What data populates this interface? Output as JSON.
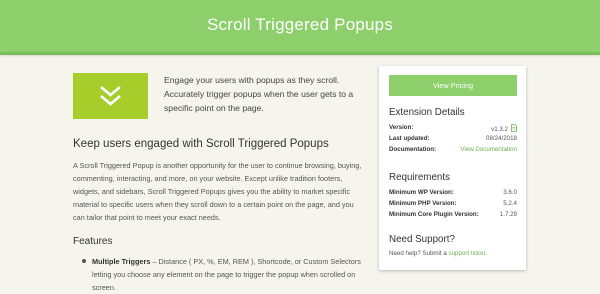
{
  "header": {
    "title": "Scroll Triggered Popups"
  },
  "hero": {
    "icon": "double-chevron-down-icon",
    "text": "Engage your users with popups as they scroll. Accurately trigger popups when the user gets to a specific point on the page."
  },
  "main": {
    "heading": "Keep users engaged with Scroll Triggered Popups",
    "body": "A Scroll Triggered Popup is another opportunity for the user to continue browsing, buying, commenting, interacting, and more, on your website. Except unlike tradition footers, widgets, and sidebars, Scroll Triggered Popups gives you the ability to market specific material to specific users when they scroll down to a certain point on the page, and you can tailor that point to meet your exact needs.",
    "features_heading": "Features",
    "features": [
      {
        "title": "Multiple Triggers",
        "text": " – Distance ( PX, %, EM, REM ), Shortcode, or Custom Selectors letting you choose any element on the page to trigger the popup when scrolled on screen."
      }
    ]
  },
  "sidebar": {
    "pricing_button": "View Pricing",
    "extension_details": {
      "title": "Extension Details",
      "version_label": "Version:",
      "version_value": "v1.3.2",
      "updated_label": "Last updated:",
      "updated_value": "08/24/2018",
      "docs_label": "Documentation:",
      "docs_value": "View Documentation"
    },
    "requirements": {
      "title": "Requirements",
      "wp_label": "Minimum WP Version:",
      "wp_value": "3.6.0",
      "php_label": "Minimum PHP Version:",
      "php_value": "5.2.4",
      "core_label": "Minimum Core Plugin Version:",
      "core_value": "1.7.29"
    },
    "support": {
      "title": "Need Support?",
      "text": "Need help? Submit a ",
      "link": "support ticket",
      "suffix": "."
    }
  },
  "colors": {
    "accent": "#8ccf6b",
    "hero_icon_bg": "#a6cd2a",
    "link": "#6bb34d",
    "page_bg": "#f5f5ee"
  }
}
